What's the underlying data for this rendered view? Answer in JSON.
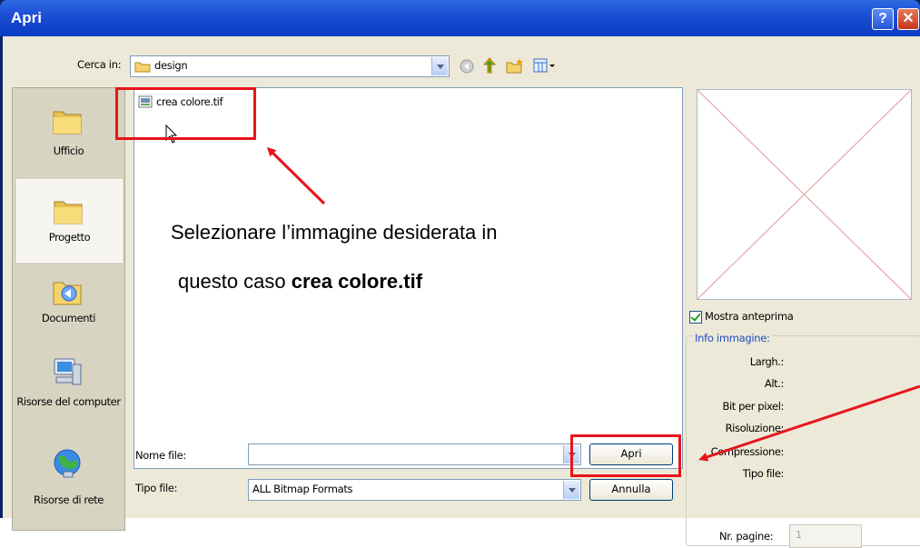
{
  "window": {
    "title": "Apri",
    "help_glyph": "?",
    "close_glyph": "✕"
  },
  "lookin": {
    "label": "Cerca in:",
    "value": "design"
  },
  "places": [
    {
      "label": "Ufficio"
    },
    {
      "label": "Progetto"
    },
    {
      "label": "Documenti"
    },
    {
      "label": "Risorse del computer"
    },
    {
      "label": "Risorse di rete"
    }
  ],
  "files": [
    {
      "name": "crea colore.tif"
    }
  ],
  "annotation": {
    "line1": "Selezionare l’immagine desiderata in",
    "line2_prefix": "questo caso ",
    "line2_bold": "crea colore.tif"
  },
  "filename": {
    "label": "Nome file:",
    "value": ""
  },
  "filetype": {
    "label": "Tipo file:",
    "value": "ALL Bitmap Formats"
  },
  "buttons": {
    "open": "Apri",
    "cancel": "Annulla"
  },
  "preview": {
    "checkbox_label": "Mostra anteprima",
    "checked": true
  },
  "info": {
    "title": "Info immagine:",
    "width": "Largh.:",
    "height": "Alt.:",
    "bpp": "Bit per pixel:",
    "resolution": "Risoluzione:",
    "compression": "Compressione:",
    "filetype": "Tipo file:"
  },
  "pages": {
    "label": "Nr. pagine:",
    "value": "1"
  },
  "colors": {
    "annotation_red": "#e8141b",
    "title_blue": "#0a3cc0"
  }
}
